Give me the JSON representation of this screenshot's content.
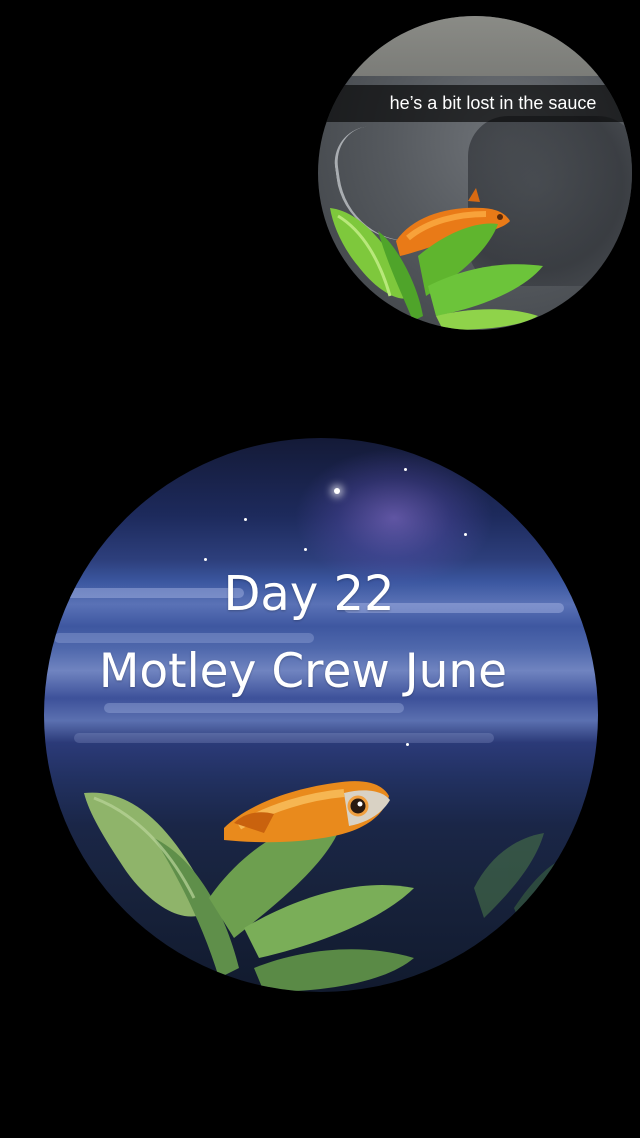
{
  "story": {
    "top_snap": {
      "caption": "he’s a bit lost in the sauce",
      "subject": "goldfish-on-plant-photo"
    },
    "main_snap": {
      "title_line1": "Day 22",
      "title_line2": "Motley Crew June",
      "subject": "painted-goldfish-over-ocean-night-sky"
    }
  },
  "colors": {
    "background": "#000000",
    "fish_orange": "#e98a1c",
    "plant_green": "#6fbf3a",
    "sky_blue": "#2d3f7c"
  }
}
